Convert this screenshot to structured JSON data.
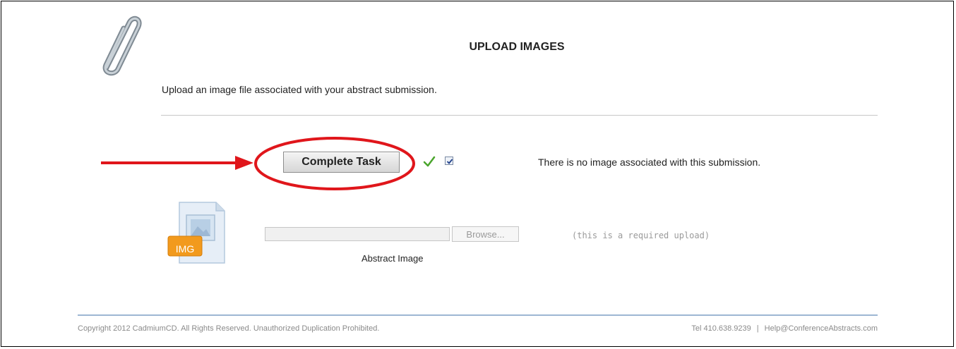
{
  "header": {
    "title": "UPLOAD IMAGES",
    "subtitle": "Upload an image file associated with your abstract submission."
  },
  "task": {
    "complete_label": "Complete Task",
    "checkbox_checked": true,
    "no_image_text": "There is no image associated with this submission."
  },
  "upload": {
    "icon_label": "IMG",
    "browse_label": "Browse...",
    "field_label": "Abstract Image",
    "required_note": "(this is a required upload)",
    "file_value": ""
  },
  "footer": {
    "copyright": "Copyright 2012 CadmiumCD. All Rights Reserved. Unauthorized Duplication Prohibited.",
    "tel": "Tel 410.638.9239",
    "separator": "|",
    "email": "Help@ConferenceAbstracts.com"
  },
  "icons": {
    "clip": "paperclip-icon",
    "check": "checkmark-icon",
    "image_file": "image-file-icon",
    "arrow": "red-arrow-annotation",
    "ellipse": "red-ellipse-annotation"
  },
  "colors": {
    "annotation": "#e0161b",
    "check_green": "#4aa52c",
    "img_badge": "#f29a1d",
    "footer_rule": "#9db7d3"
  }
}
